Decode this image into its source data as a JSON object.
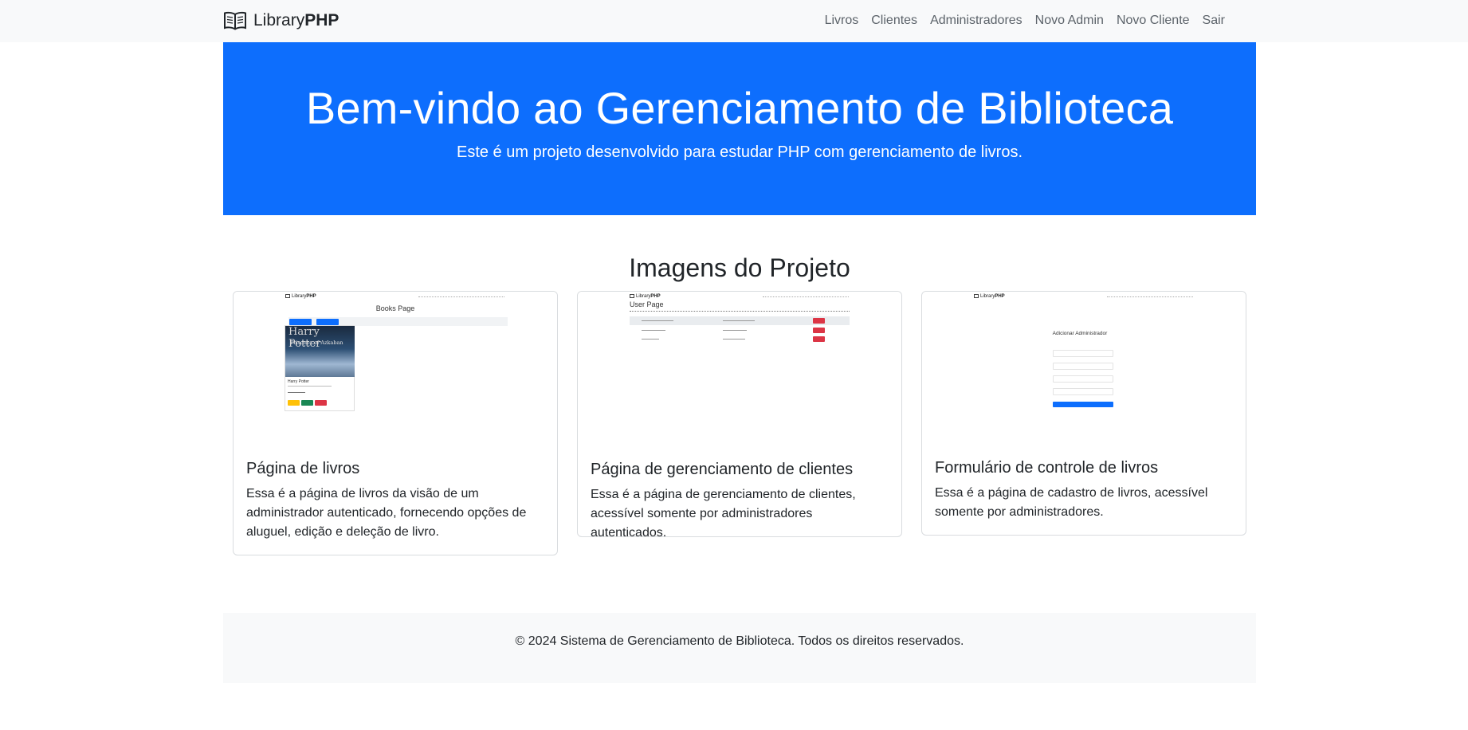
{
  "navbar": {
    "brand_light": "Library",
    "brand_bold": "PHP",
    "links": [
      "Livros",
      "Clientes",
      "Administradores",
      "Novo Admin",
      "Novo Cliente",
      "Sair"
    ]
  },
  "hero": {
    "title": "Bem-vindo ao Gerenciamento de Biblioteca",
    "subtitle": "Este é um projeto desenvolvido para estudar PHP com gerenciamento de livros."
  },
  "section": {
    "title": "Imagens do Projeto"
  },
  "cards": [
    {
      "title": "Página de livros",
      "text": "Essa é a página de livros da visão de um administrador autenticado, fornecendo opções de aluguel, edição e deleção de livro.",
      "thumbnail": {
        "heading": "Books Page",
        "book_title": "Harry Potter",
        "cover_text": "Prisoner of Azkaban"
      }
    },
    {
      "title": "Página de gerenciamento de clientes",
      "text": "Essa é a página de gerenciamento de clientes, acessível somente por administradores autenticados.",
      "thumbnail": {
        "heading": "User Page"
      }
    },
    {
      "title": "Formulário de controle de livros",
      "text": "Essa é a página de cadastro de livros, acessível somente por administradores.",
      "thumbnail": {
        "heading": "Adicionar Administrador"
      }
    }
  ],
  "footer": {
    "text": "© 2024 Sistema de Gerenciamento de Biblioteca. Todos os direitos reservados."
  },
  "colors": {
    "primary": "#0d6efd",
    "navbar_bg": "#f8f9fa",
    "danger": "#dc3545",
    "warning": "#ffc107",
    "success": "#198754"
  }
}
